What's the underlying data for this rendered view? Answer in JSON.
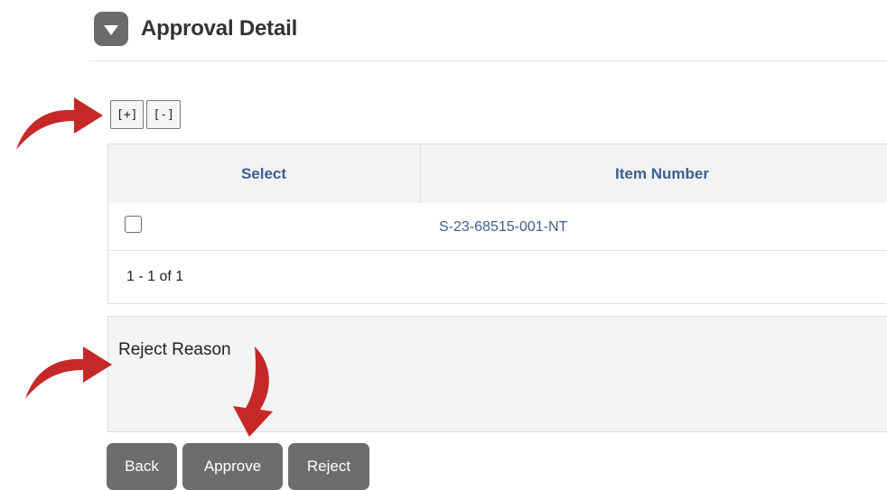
{
  "header": {
    "title": "Approval Detail",
    "toggle_icon": "chevron-down-icon"
  },
  "tree_buttons": {
    "expand_label": "[+]",
    "collapse_label": "[-]"
  },
  "grid": {
    "columns": [
      "Select",
      "Item Number"
    ],
    "rows": [
      {
        "selected": false,
        "item_number": "S-23-68515-001-NT"
      }
    ],
    "pager_text": "1 - 1 of 1"
  },
  "reject_reason": {
    "label": "Reject Reason",
    "value": ""
  },
  "actions": {
    "back_label": "Back",
    "approve_label": "Approve",
    "reject_label": "Reject"
  },
  "colors": {
    "button_gray": "#6d6d6d",
    "link_blue": "#3d5f8f",
    "annotation_red": "#c62828"
  }
}
